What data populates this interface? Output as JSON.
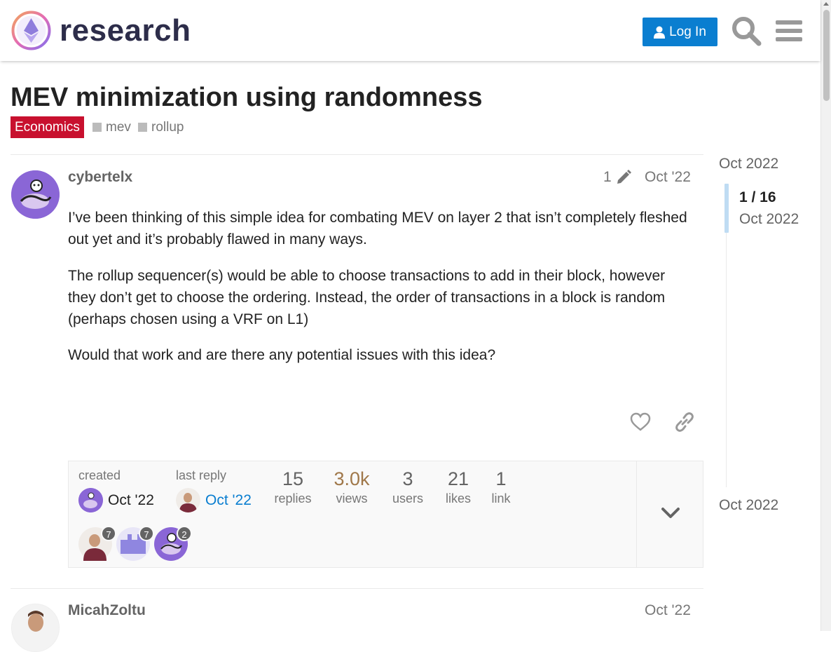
{
  "header": {
    "logo_text": "research",
    "login_label": "Log In"
  },
  "topic": {
    "title": "MEV minimization using randomness",
    "category": "Economics",
    "category_color": "#c8102e",
    "tags": [
      "mev",
      "rollup"
    ]
  },
  "first_post": {
    "username": "cybertelx",
    "edit_count": "1",
    "date": "Oct '22",
    "paragraphs": [
      "I’ve been thinking of this simple idea for combating MEV on layer 2 that isn’t completely fleshed out yet and it’s probably flawed in many ways.",
      "The rollup sequencer(s) would be able to choose transactions to add in their block, however they don’t get to choose the ordering. Instead, the order of transactions in a block is random (perhaps chosen using a VRF on L1)",
      "Would that work and are there any potential issues with this idea?"
    ]
  },
  "topic_map": {
    "created_label": "created",
    "created_date": "Oct '22",
    "last_reply_label": "last reply",
    "last_reply_date": "Oct '22",
    "stats": [
      {
        "num": "15",
        "label": "replies"
      },
      {
        "num": "3.0k",
        "label": "views"
      },
      {
        "num": "3",
        "label": "users"
      },
      {
        "num": "21",
        "label": "likes"
      },
      {
        "num": "1",
        "label": "link"
      }
    ],
    "participants": [
      {
        "count": "7"
      },
      {
        "count": "7"
      },
      {
        "count": "2"
      }
    ]
  },
  "second_post": {
    "username": "MicahZoltu",
    "date": "Oct '22"
  },
  "timeline": {
    "start_date": "Oct 2022",
    "position": "1 / 16",
    "position_date": "Oct 2022",
    "end_date": "Oct 2022"
  },
  "colors": {
    "accent": "#0a7ed0",
    "views_highlight": "#a0784a"
  }
}
